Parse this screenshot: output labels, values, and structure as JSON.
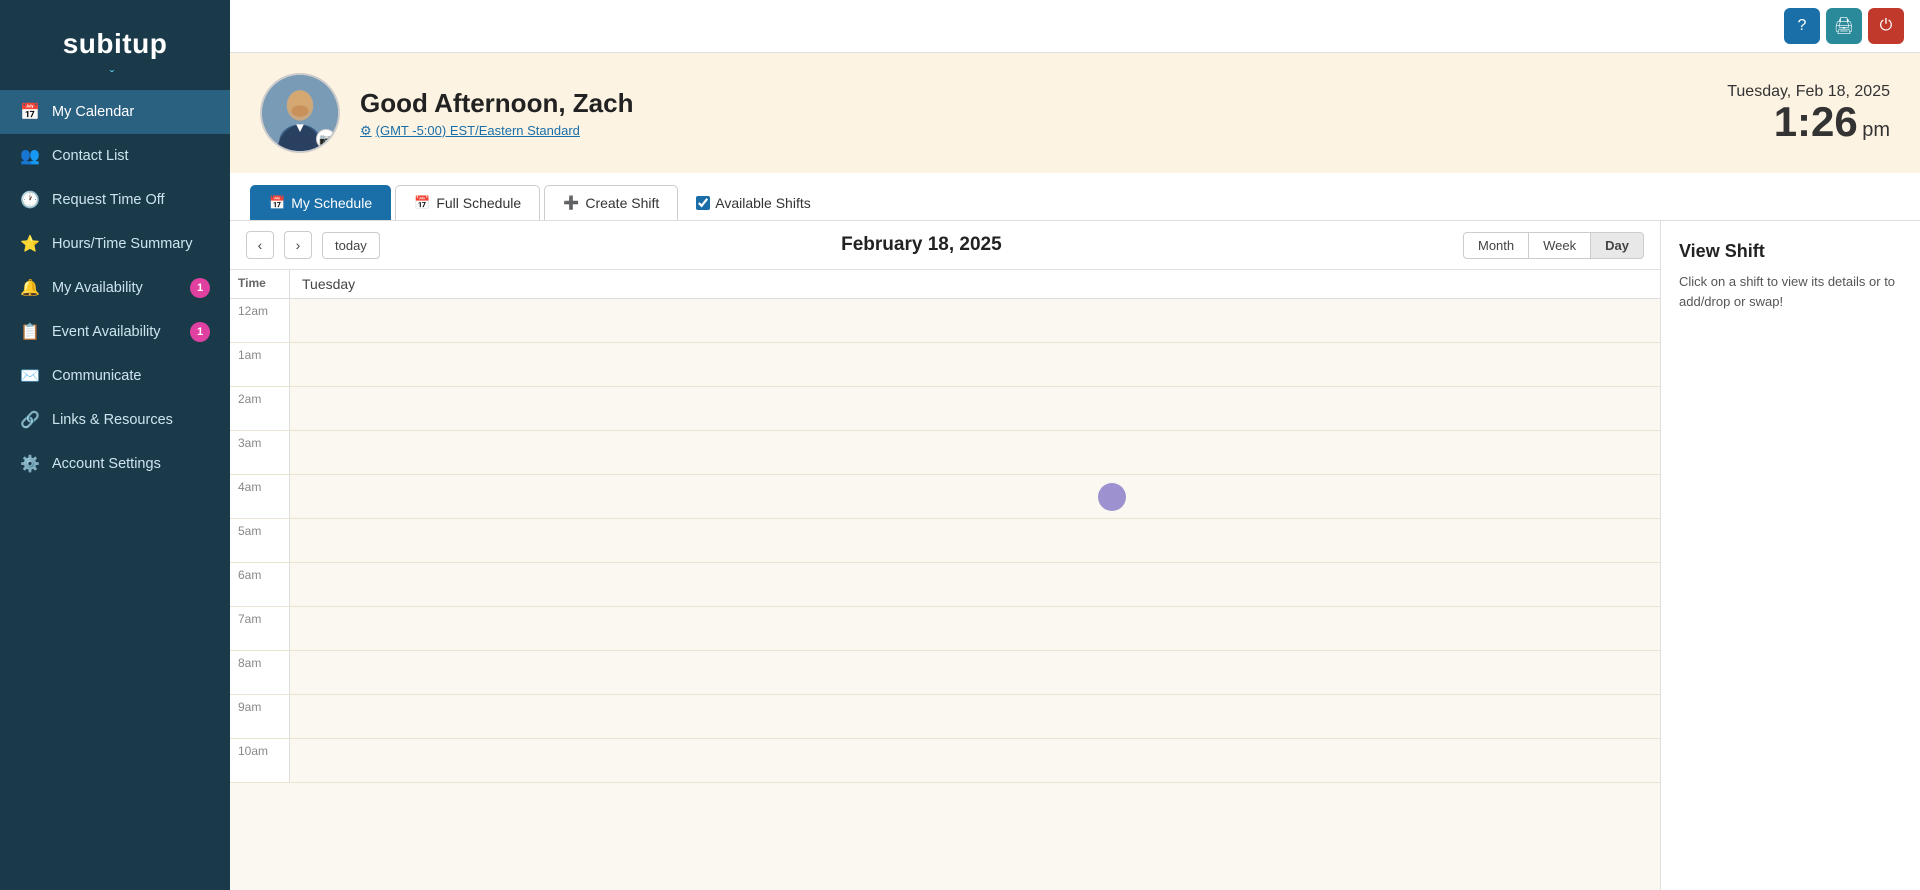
{
  "sidebar": {
    "logo": "subitup",
    "logo_smile": "ˬ",
    "items": [
      {
        "id": "my-calendar",
        "label": "My Calendar",
        "icon": "📅",
        "active": true,
        "badge": null
      },
      {
        "id": "contact-list",
        "label": "Contact List",
        "icon": "👥",
        "active": false,
        "badge": null
      },
      {
        "id": "request-time-off",
        "label": "Request Time Off",
        "icon": "🕐",
        "active": false,
        "badge": null
      },
      {
        "id": "hours-time-summary",
        "label": "Hours/Time Summary",
        "icon": "⭐",
        "active": false,
        "badge": null
      },
      {
        "id": "my-availability",
        "label": "My Availability",
        "icon": "🔔",
        "active": false,
        "badge": "1"
      },
      {
        "id": "event-availability",
        "label": "Event Availability",
        "icon": "📋",
        "active": false,
        "badge": "1"
      },
      {
        "id": "communicate",
        "label": "Communicate",
        "icon": "✉️",
        "active": false,
        "badge": null
      },
      {
        "id": "links-resources",
        "label": "Links & Resources",
        "icon": "🔗",
        "active": false,
        "badge": null
      },
      {
        "id": "account-settings",
        "label": "Account Settings",
        "icon": "⚙️",
        "active": false,
        "badge": null
      }
    ]
  },
  "topbar": {
    "help_label": "?",
    "print_label": "🖨",
    "power_label": "⏻"
  },
  "header": {
    "greeting": "Good Afternoon, Zach",
    "timezone": "(GMT -5:00) EST/Eastern Standard",
    "date": "Tuesday, Feb 18, 2025",
    "time": "1:26",
    "ampm": "pm"
  },
  "tabs": [
    {
      "id": "my-schedule",
      "label": "My Schedule",
      "icon": "📅",
      "active": true
    },
    {
      "id": "full-schedule",
      "label": "Full Schedule",
      "icon": "📅",
      "active": false
    },
    {
      "id": "create-shift",
      "label": "Create Shift",
      "icon": "➕",
      "active": false
    },
    {
      "id": "available-shifts",
      "label": "Available Shifts",
      "icon": "☑",
      "active": false,
      "checkbox": true
    }
  ],
  "calendar": {
    "title": "February 18, 2025",
    "today_label": "today",
    "view_buttons": [
      {
        "id": "month",
        "label": "Month",
        "active": false
      },
      {
        "id": "week",
        "label": "Week",
        "active": false
      },
      {
        "id": "day",
        "label": "Day",
        "active": true
      }
    ],
    "col_time": "Time",
    "col_day": "Tuesday",
    "time_slots": [
      "12am",
      "1am",
      "2am",
      "3am",
      "4am",
      "5am",
      "6am",
      "7am",
      "8am",
      "9am",
      "10am"
    ],
    "cursor_row": 4
  },
  "view_shift": {
    "title": "View Shift",
    "description": "Click on a shift to view its details or to add/drop or swap!"
  }
}
